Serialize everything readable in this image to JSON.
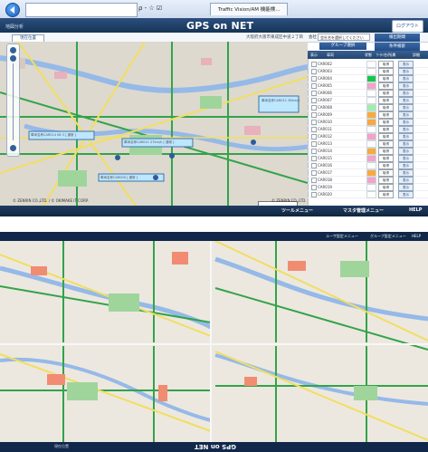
{
  "browser": {
    "address_tools": "ρ - ☆ ☑",
    "tab_title": "Traffic Vision/AM 機能検..."
  },
  "header": {
    "app_title": "GPS on NET",
    "logout_label": "ログアウト",
    "crumb": "地図分析"
  },
  "controls": {
    "current_location_label": "現在位置",
    "area_text": "大阪府大阪市東成区中道２丁目",
    "company_label": "会社",
    "company_value": "会社名を選択してください",
    "condition_label": "検出期間",
    "group_select_label": "グループ選択",
    "condition2_label": "条件検索"
  },
  "table": {
    "headers": [
      "表示",
      "車両",
      "状態",
      "ｹｰﾀｲ名/所属",
      "詳細"
    ],
    "rows": [
      {
        "id": "CAR002",
        "status_color": "#ffffff",
        "action": "取得",
        "display": "表示"
      },
      {
        "id": "CAR003",
        "status_color": "#ffffff",
        "action": "取得",
        "display": "表示"
      },
      {
        "id": "CAR004",
        "status_color": "#12c84a",
        "action": "取得",
        "display": "表示"
      },
      {
        "id": "CAR005",
        "status_color": "#f3a3c6",
        "action": "取得",
        "display": "表示"
      },
      {
        "id": "CAR006",
        "status_color": "#ffffff",
        "action": "取得",
        "display": "表示"
      },
      {
        "id": "CAR007",
        "status_color": "#ffffff",
        "action": "取得",
        "display": "表示"
      },
      {
        "id": "CAR008",
        "status_color": "#9ef0a9",
        "action": "取得",
        "display": "表示"
      },
      {
        "id": "CAR009",
        "status_color": "#f8aa3c",
        "action": "取得",
        "display": "表示"
      },
      {
        "id": "CAR010",
        "status_color": "#f8aa3c",
        "action": "取得",
        "display": "表示"
      },
      {
        "id": "CAR011",
        "status_color": "#ffffff",
        "action": "取得",
        "display": "表示"
      },
      {
        "id": "CAR012",
        "status_color": "#f3a3c6",
        "action": "取得",
        "display": "表示"
      },
      {
        "id": "CAR013",
        "status_color": "#ffffff",
        "action": "取得",
        "display": "表示"
      },
      {
        "id": "CAR014",
        "status_color": "#f8aa3c",
        "action": "取得",
        "display": "表示"
      },
      {
        "id": "CAR015",
        "status_color": "#f3a3c6",
        "action": "取得",
        "display": "表示"
      },
      {
        "id": "CAR016",
        "status_color": "#ffffff",
        "action": "取得",
        "display": "表示"
      },
      {
        "id": "CAR017",
        "status_color": "#f8aa3c",
        "action": "取得",
        "display": "表示"
      },
      {
        "id": "CAR018",
        "status_color": "#f3a3c6",
        "action": "取得",
        "display": "表示"
      },
      {
        "id": "CAR019",
        "status_color": "#ffffff",
        "action": "取得",
        "display": "表示"
      },
      {
        "id": "CAR020",
        "status_color": "#ffffff",
        "action": "取得",
        "display": "表示"
      }
    ]
  },
  "map_top": {
    "footer_left": "© ZENRIN CO.,LTD. / © OKIMAKE IT CORP.",
    "footer_right": "© ZENRIN CO.,LTD.",
    "labels": [
      "車両名称CAR014 06 3 [ 通常 ]",
      "車両名称CAR011 27km/h [ 通常 ]",
      "車両名称CAR011 30km/h",
      "車両名称CAR000 [ 通常 ]"
    ]
  },
  "toolbar_bottom": {
    "tool_menu": "ツールメニュー",
    "master_menu": "マスタ管理メニュー",
    "help": "HELP"
  },
  "lower": {
    "top_items": [
      "ユーザ設定メニュー",
      "グループ設定メニュー",
      "HELP"
    ],
    "bottom_title": "GPS on NET",
    "bottom_left": "現在位置"
  },
  "colors": {
    "map_bg": "#ddd9cf",
    "road_green": "#33a34a",
    "road_yellow": "#f1de62",
    "water": "#95b9e8",
    "park": "#9fd59b",
    "accent": "#2c4f7f"
  }
}
